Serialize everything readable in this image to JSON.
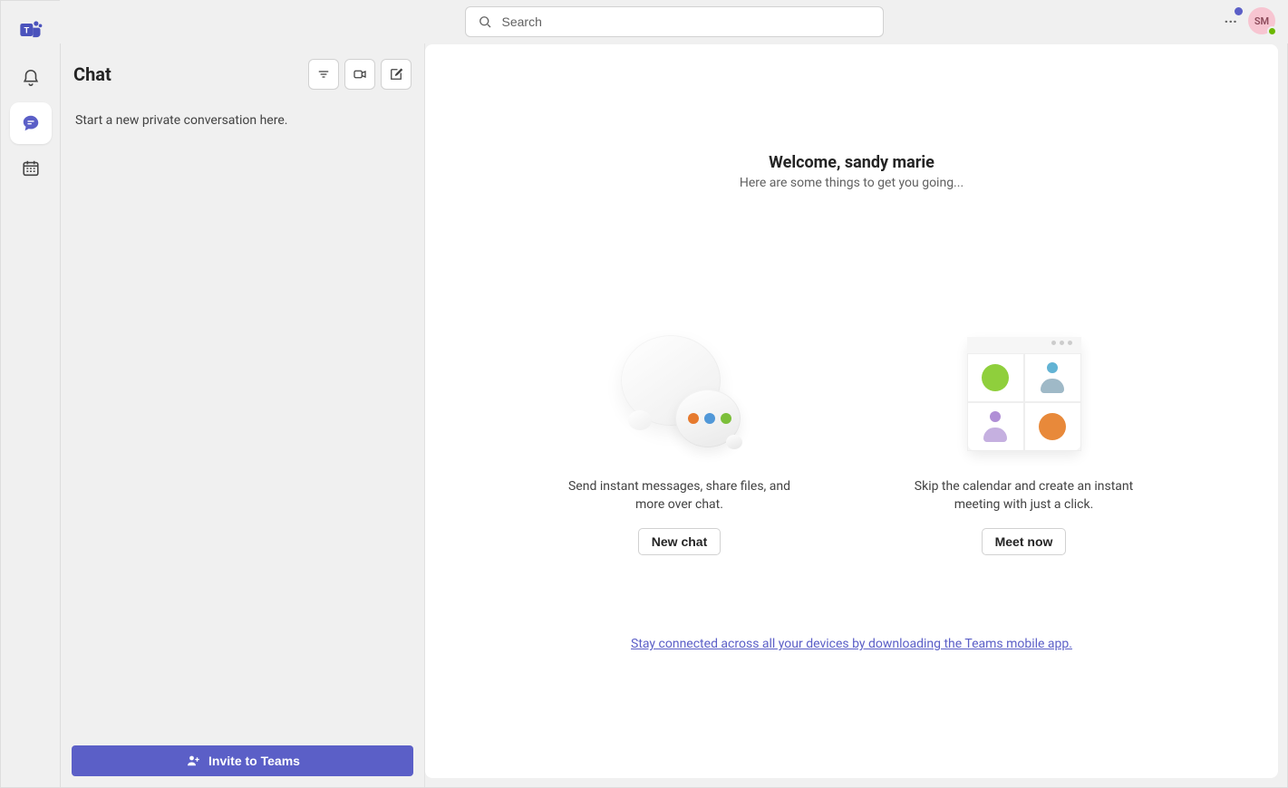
{
  "header": {
    "search_placeholder": "Search",
    "avatar_initials": "SM"
  },
  "sidebar": {
    "title": "Chat",
    "empty_text": "Start a new private conversation here.",
    "invite_label": "Invite to Teams"
  },
  "welcome": {
    "title": "Welcome, sandy marie",
    "subtitle": "Here are some things to get you going..."
  },
  "tiles": {
    "chat": {
      "desc": "Send instant messages, share files, and more over chat.",
      "button": "New chat"
    },
    "meet": {
      "desc": "Skip the calendar and create an instant meeting with just a click.",
      "button": "Meet now"
    }
  },
  "mobile_link": "Stay connected across all your devices by downloading the Teams mobile app."
}
